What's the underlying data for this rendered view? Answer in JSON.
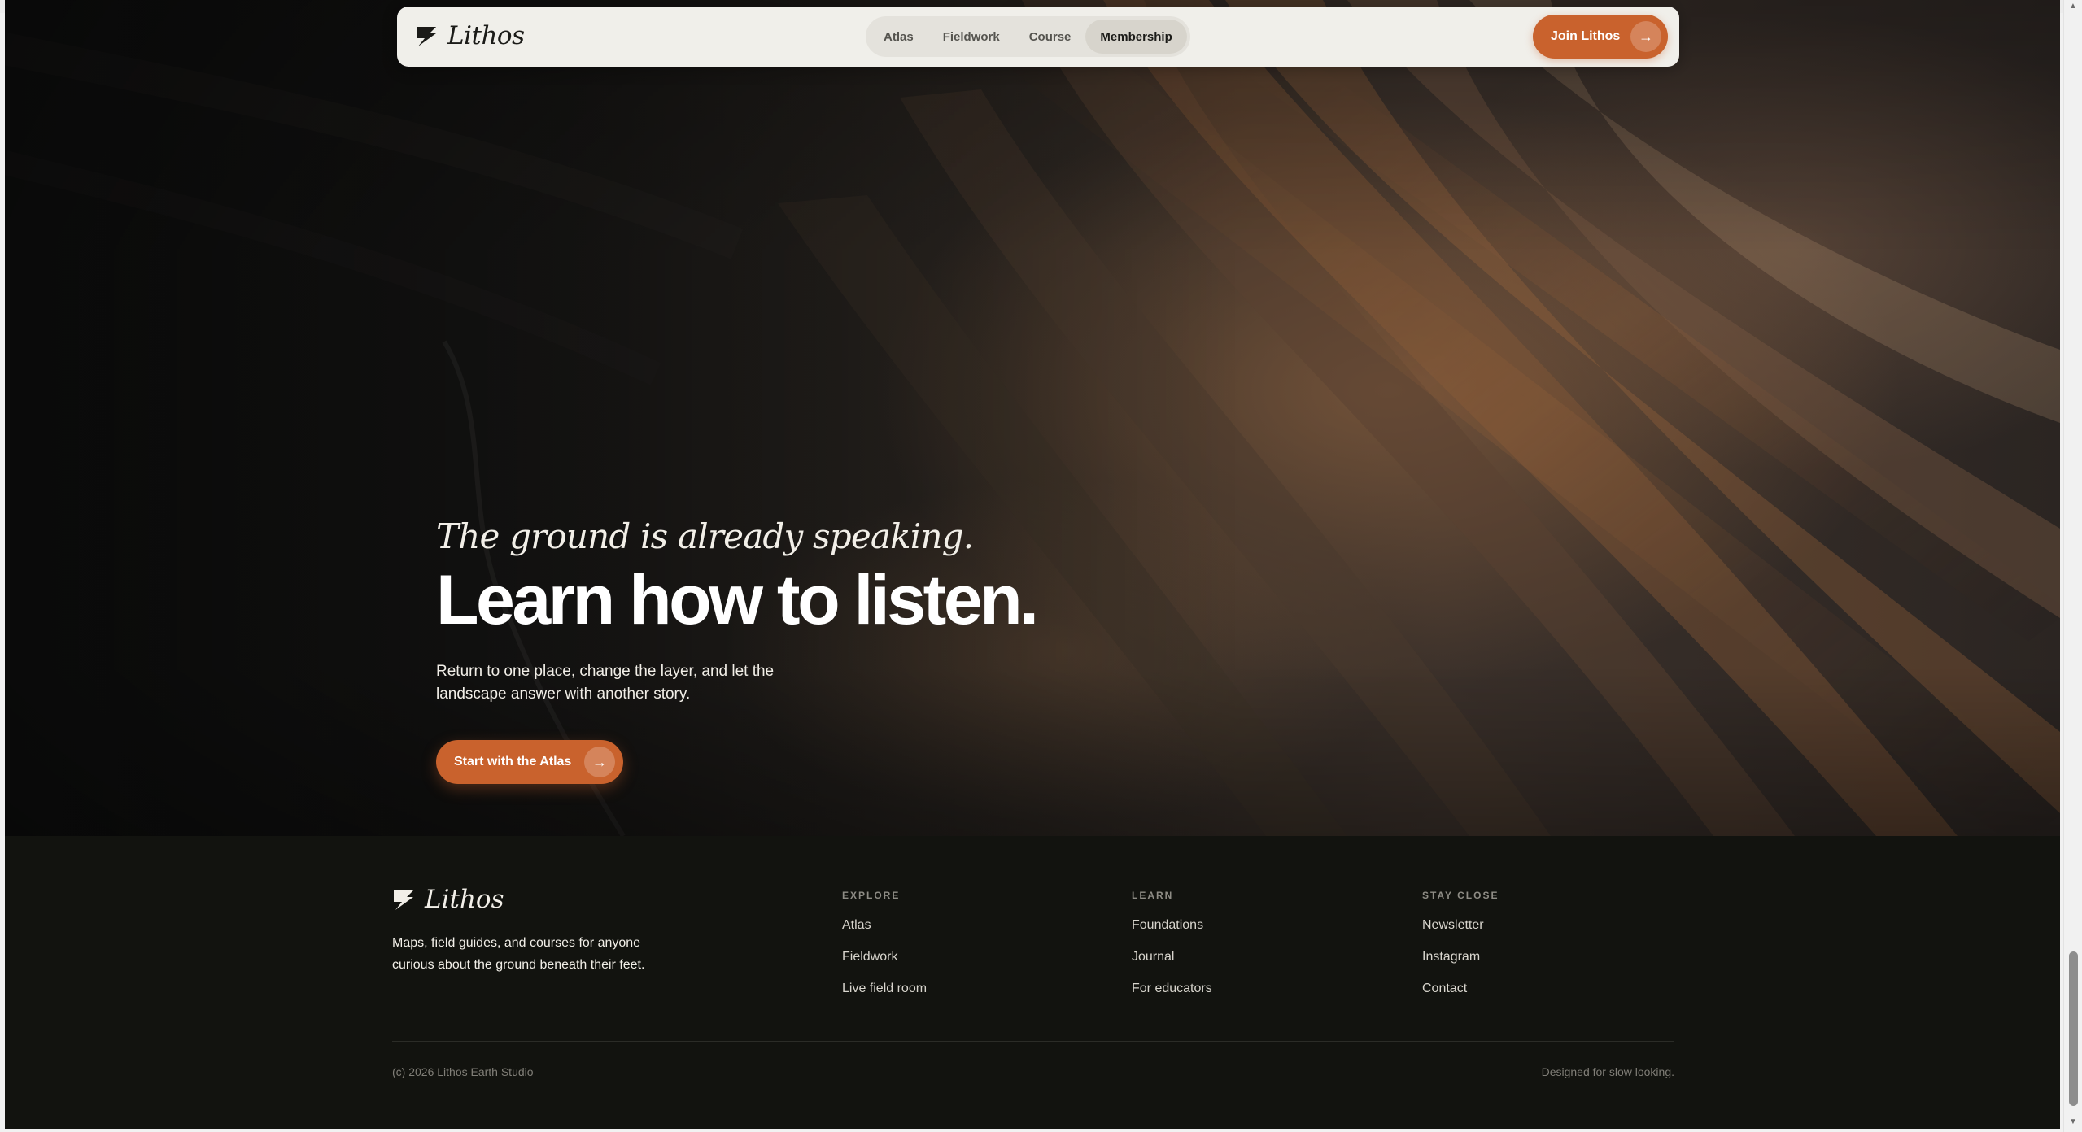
{
  "brand": {
    "name": "Lithos"
  },
  "nav": {
    "links": [
      "Atlas",
      "Fieldwork",
      "Course",
      "Membership"
    ],
    "active": "Membership",
    "join_label": "Join Lithos"
  },
  "hero": {
    "kicker": "The ground is already speaking.",
    "headline": "Learn how to listen.",
    "lede": "Return to one place, change the layer, and let the landscape answer with another story.",
    "cta_label": "Start with the Atlas"
  },
  "footer": {
    "description": "Maps, field guides, and courses for anyone curious about the ground beneath their feet.",
    "columns": [
      {
        "heading": "EXPLORE",
        "items": [
          "Atlas",
          "Fieldwork",
          "Live field room"
        ]
      },
      {
        "heading": "LEARN",
        "items": [
          "Foundations",
          "Journal",
          "For educators"
        ]
      },
      {
        "heading": "STAY CLOSE",
        "items": [
          "Newsletter",
          "Instagram",
          "Contact"
        ]
      }
    ],
    "copyright": "(c) 2026 Lithos Earth Studio",
    "tagline": "Designed for slow looking."
  },
  "colors": {
    "accent": "#c9622d",
    "footer_bg": "#12130f",
    "nav_bg": "#f0efea"
  },
  "icons": {
    "logo": "lithos-strata-mark",
    "arrow": "arrow-right-icon"
  }
}
